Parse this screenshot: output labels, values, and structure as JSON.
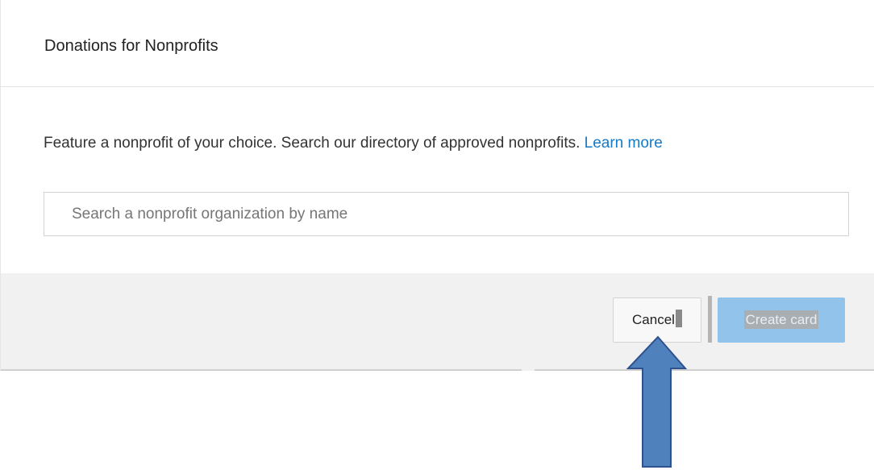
{
  "dialog": {
    "title": "Donations for Nonprofits",
    "description": "Feature a nonprofit of your choice. Search our directory of approved nonprofits.",
    "learn_more_label": "Learn more",
    "search": {
      "placeholder": "Search a nonprofit organization by name",
      "value": ""
    },
    "footer": {
      "cancel_label": "Cancel",
      "create_card_label": "Create card",
      "create_card_enabled": false
    }
  },
  "annotation": {
    "type": "arrow-up",
    "target": "cancel-button",
    "color": "#4f81bd",
    "border_color": "#2f528f"
  },
  "colors": {
    "link": "#167ac6",
    "primary_button_disabled": "#92c3ea",
    "footer_background": "#f1f1f1"
  }
}
